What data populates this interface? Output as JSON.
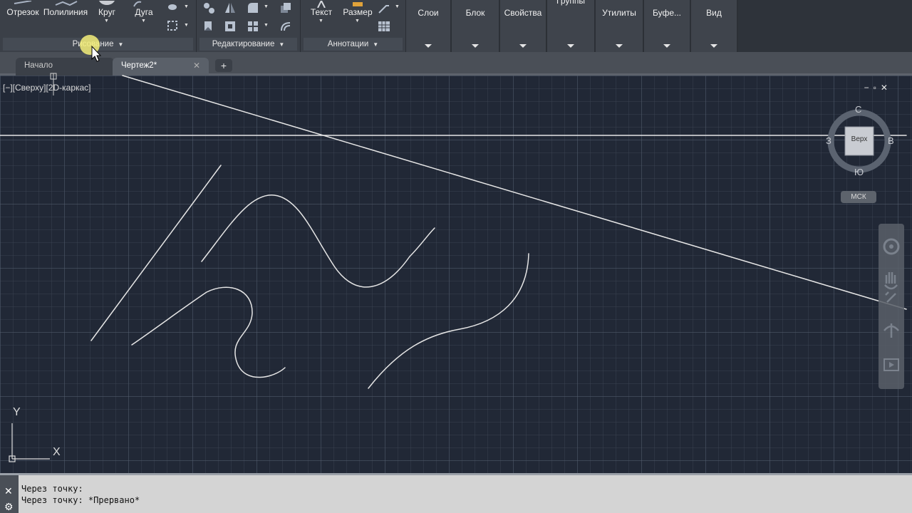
{
  "ribbon": {
    "draw_panel": {
      "title": "Рисование",
      "tools": [
        "Отрезок",
        "Полилиния",
        "Круг",
        "Дуга"
      ]
    },
    "modify_panel": {
      "title": "Редактирование"
    },
    "annotation_panel": {
      "title": "Аннотации",
      "tools": [
        "Текст",
        "Размер"
      ]
    },
    "big_panels": [
      "Слои",
      "Блок",
      "Свойства",
      "Группы",
      "Утилиты",
      "Буфе...",
      "Вид"
    ]
  },
  "tabs": {
    "start": "Начало",
    "drawing": "Чертеж2*",
    "close": "✕",
    "new": "+"
  },
  "viewport": {
    "label": "[−][Сверху][2D-каркас]",
    "controls": "−▫✕"
  },
  "viewcube": {
    "face": "Верх",
    "north": "С",
    "south": "Ю",
    "east": "В",
    "west": "З",
    "ucs": "МСК"
  },
  "ucs_icon": {
    "x": "X",
    "y": "Y"
  },
  "command_line": {
    "lines": [
      "Через точку:",
      "Через точку: *Прервано*"
    ]
  },
  "colors": {
    "canvas_bg": "#212836",
    "ribbon_bg": "#3b4048",
    "geometry": "#e8e8e8",
    "cursor_highlight": "#f5ef7a"
  }
}
